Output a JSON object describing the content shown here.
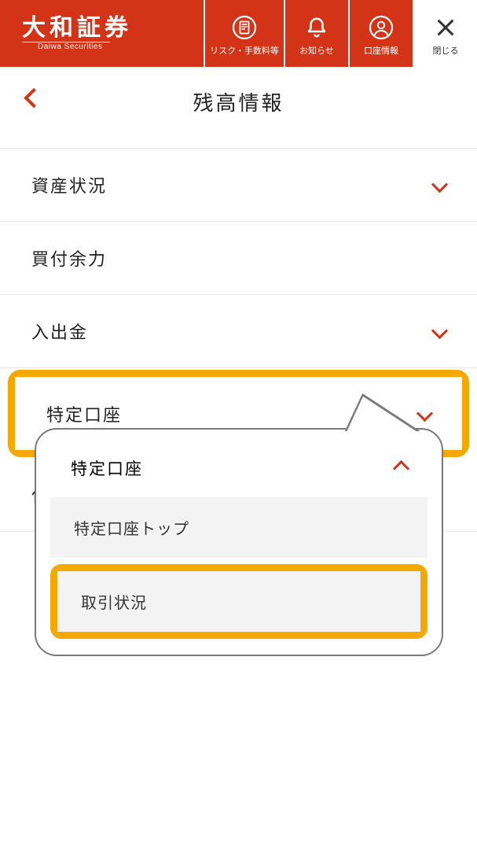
{
  "header": {
    "brand_main": "大和証券",
    "brand_sub": "Daiwa Securities",
    "risk_label": "リスク・手数料等",
    "notice_label": "お知らせ",
    "account_label": "口座情報",
    "close_label": "閉じる"
  },
  "page": {
    "title": "残高情報"
  },
  "menu": {
    "items": [
      {
        "label": "資産状況",
        "expandable": true
      },
      {
        "label": "買付余力",
        "expandable": false
      },
      {
        "label": "入出金",
        "expandable": true
      },
      {
        "label": "特定口座",
        "expandable": true,
        "highlighted": true
      },
      {
        "label": "保険契約状況",
        "expandable": false
      }
    ]
  },
  "callout": {
    "header": "特定口座",
    "items": [
      {
        "label": "特定口座トップ"
      },
      {
        "label": "取引状況",
        "highlighted": true
      }
    ]
  },
  "colors": {
    "brand": "#d33417",
    "highlight": "#f5a800"
  }
}
